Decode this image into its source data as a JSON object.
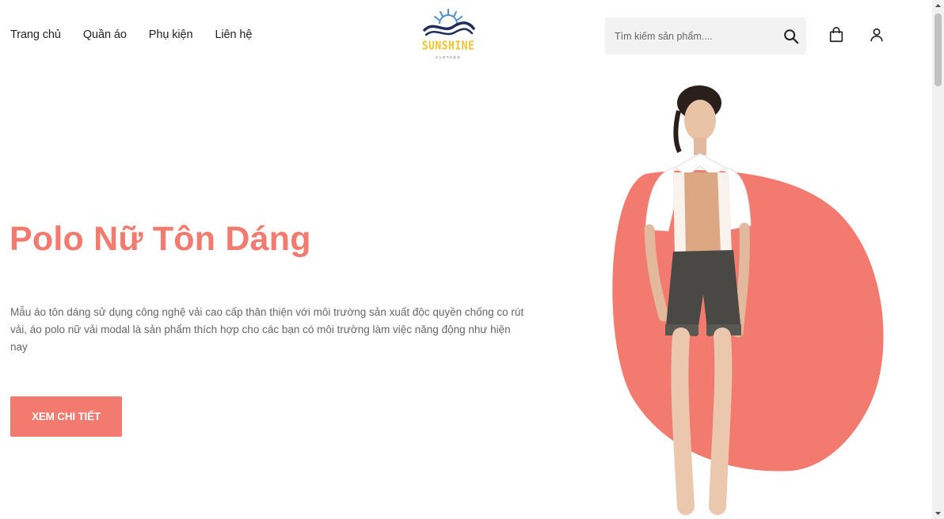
{
  "nav": {
    "items": [
      {
        "label": "Trang chủ"
      },
      {
        "label": "Quần áo"
      },
      {
        "label": "Phụ kiện"
      },
      {
        "label": "Liên hệ"
      }
    ]
  },
  "logo": {
    "brand": "SUNSHINE",
    "tagline": "CLOTHES"
  },
  "search": {
    "placeholder": "Tìm kiếm sản phẩm...."
  },
  "header_icons": [
    "search-icon",
    "shopping-bag-icon",
    "user-icon"
  ],
  "hero": {
    "title": "Polo Nữ Tôn Dáng",
    "description": "Mẫu áo tôn dáng sử dụng công nghệ vải cao cấp thân thiện với môi trường sản xuất độc quyền chống co rút vải, áo polo nữ vải modal là sản phẩm thích hợp cho các bạn có môi trường làm việc năng động như hiện nay",
    "cta_label": "XEM CHI TIẾT"
  },
  "colors": {
    "accent": "#f37a6e",
    "logo_yellow": "#f2c230",
    "logo_navy": "#1e2f5a",
    "search_bg": "#f2f2f2"
  }
}
